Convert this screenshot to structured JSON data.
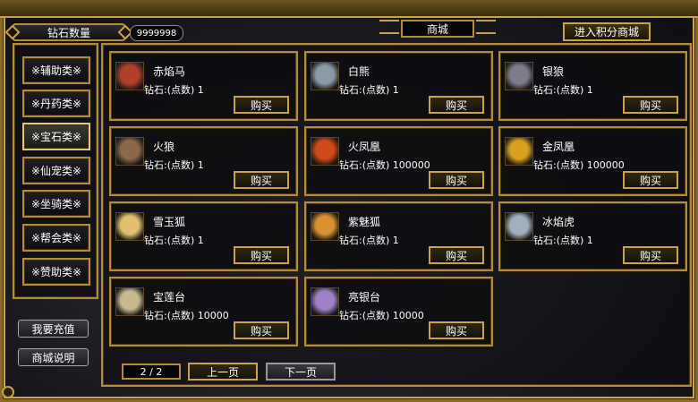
{
  "header": {
    "diamond_label": "钻石数量",
    "diamond_value": "9999998",
    "shop_title": "商城",
    "points_shop_label": "进入积分商城"
  },
  "categories": [
    {
      "label": "※辅助类※",
      "active": false
    },
    {
      "label": "※丹药类※",
      "active": false
    },
    {
      "label": "※宝石类※",
      "active": true
    },
    {
      "label": "※仙宠类※",
      "active": false
    },
    {
      "label": "※坐骑类※",
      "active": false
    },
    {
      "label": "※帮会类※",
      "active": false
    },
    {
      "label": "※赞助类※",
      "active": false
    }
  ],
  "side_actions": {
    "recharge": "我要充值",
    "help": "商城说明"
  },
  "items": [
    {
      "name": "赤焰马",
      "price": "钻石:(点数) 1",
      "buy": "购买",
      "icon": "red-flame-horse-icon",
      "color": "#b0402a"
    },
    {
      "name": "白熊",
      "price": "钻石:(点数) 1",
      "buy": "购买",
      "icon": "white-bear-icon",
      "color": "#8a9aa8"
    },
    {
      "name": "银狼",
      "price": "钻石:(点数) 1",
      "buy": "购买",
      "icon": "silver-wolf-icon",
      "color": "#7c7c8c"
    },
    {
      "name": "火狼",
      "price": "钻石:(点数) 1",
      "buy": "购买",
      "icon": "fire-wolf-icon",
      "color": "#8a6a4a"
    },
    {
      "name": "火凤凰",
      "price": "钻石:(点数) 100000",
      "buy": "购买",
      "icon": "fire-phoenix-icon",
      "color": "#d04a1a"
    },
    {
      "name": "金凤凰",
      "price": "钻石:(点数) 100000",
      "buy": "购买",
      "icon": "gold-phoenix-icon",
      "color": "#d8a020"
    },
    {
      "name": "雪玉狐",
      "price": "钻石:(点数) 1",
      "buy": "购买",
      "icon": "snow-fox-icon",
      "color": "#e0c070"
    },
    {
      "name": "紫魅狐",
      "price": "钻石:(点数) 1",
      "buy": "购买",
      "icon": "purple-fox-icon",
      "color": "#d89030"
    },
    {
      "name": "冰焰虎",
      "price": "钻石:(点数) 1",
      "buy": "购买",
      "icon": "ice-tiger-icon",
      "color": "#a0b0c0"
    },
    {
      "name": "宝莲台",
      "price": "钻石:(点数) 10000",
      "buy": "购买",
      "icon": "lotus-platform-icon",
      "color": "#c8b890"
    },
    {
      "name": "亮银台",
      "price": "钻石:(点数) 10000",
      "buy": "购买",
      "icon": "silver-platform-icon",
      "color": "#a080c8"
    }
  ],
  "pager": {
    "page": "2 / 2",
    "prev": "上一页",
    "next": "下一页"
  }
}
